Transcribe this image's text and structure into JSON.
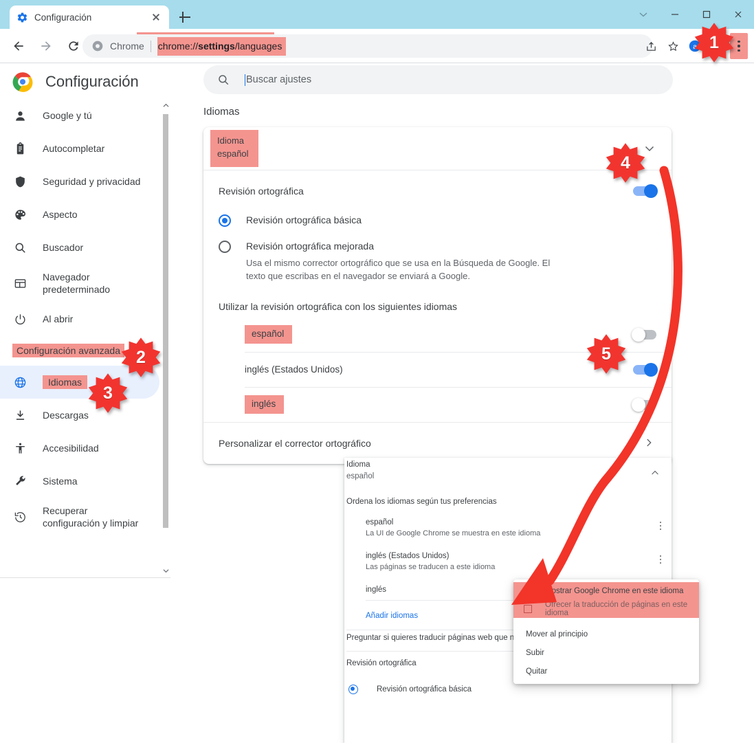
{
  "window": {
    "tab_title": "Configuración",
    "tab_favicon": "gear-icon",
    "controls": [
      "chevron-down-icon",
      "minimize-icon",
      "maximize-icon",
      "close-icon"
    ]
  },
  "omnibox": {
    "scope_label": "Chrome",
    "url_prefix": "chrome://",
    "url_bold": "settings",
    "url_suffix": "/languages",
    "url_full": "chrome://settings/languages"
  },
  "toolbar": {
    "back": "back-arrow-icon",
    "forward": "forward-arrow-icon",
    "reload": "reload-icon",
    "share": "share-icon",
    "bookmark": "star-icon",
    "profile": "avatar-a-icon",
    "extensions": "puzzle-icon",
    "menu": "three-dot-menu-icon"
  },
  "settings": {
    "brand_title": "Configuración",
    "search_placeholder": "Buscar ajustes",
    "search_value": ""
  },
  "sidebar": {
    "items": [
      {
        "label": "Google y tú",
        "icon": "person-icon"
      },
      {
        "label": "Autocompletar",
        "icon": "clipboard-icon"
      },
      {
        "label": "Seguridad y privacidad",
        "icon": "shield-icon"
      },
      {
        "label": "Aspecto",
        "icon": "palette-icon"
      },
      {
        "label": "Buscador",
        "icon": "search-icon"
      },
      {
        "label": "Navegador predeterminado",
        "icon": "browser-window-icon"
      },
      {
        "label": "Al abrir",
        "icon": "power-icon"
      }
    ],
    "advanced_label": "Configuración avanzada",
    "advanced_items": [
      {
        "label": "Idiomas",
        "icon": "globe-icon",
        "selected": true
      },
      {
        "label": "Descargas",
        "icon": "download-icon",
        "selected": false
      },
      {
        "label": "Accesibilidad",
        "icon": "accessibility-icon",
        "selected": false
      },
      {
        "label": "Sistema",
        "icon": "wrench-icon",
        "selected": false
      },
      {
        "label": "Recuperar configuración y limpiar",
        "icon": "history-icon",
        "selected": false
      }
    ]
  },
  "main": {
    "section_title": "Idiomas",
    "language_card": {
      "title": "Idioma",
      "value": "español",
      "expand_icon": "chevron-down-icon"
    },
    "spellcheck": {
      "label": "Revisión ortográfica",
      "enabled": true,
      "options": [
        {
          "title": "Revisión ortográfica básica",
          "desc": "",
          "checked": true
        },
        {
          "title": "Revisión ortográfica mejorada",
          "desc": "Usa el mismo corrector ortográfico que se usa en la Búsqueda de Google. El texto que escribas en el navegador se enviará a Google.",
          "checked": false
        }
      ],
      "languages_header": "Utilizar la revisión ortográfica con los siguientes idiomas",
      "languages": [
        {
          "name": "español",
          "enabled": false,
          "highlighted": true
        },
        {
          "name": "inglés (Estados Unidos)",
          "enabled": true,
          "highlighted": false
        },
        {
          "name": "inglés",
          "enabled": false,
          "highlighted": true
        }
      ],
      "customize_label": "Personalizar el corrector ortográfico"
    }
  },
  "overlay": {
    "title": "Idioma",
    "value": "español",
    "collapse_icon": "chevron-up-icon",
    "order_header": "Ordena los idiomas según tus preferencias",
    "languages": [
      {
        "name": "español",
        "desc": "La UI de Google Chrome se muestra en este idioma"
      },
      {
        "name": "inglés (Estados Unidos)",
        "desc": "Las páginas se traducen a este idioma"
      },
      {
        "name": "inglés",
        "desc": ""
      }
    ],
    "add_languages_label": "Añadir idiomas",
    "translate_prompt": "Preguntar si quieres traducir páginas web que no están es",
    "spellcheck_label": "Revisión ortográfica",
    "spellcheck_option": "Revisión ortográfica básica"
  },
  "context_menu": {
    "checkbox_items": [
      {
        "label": "Mostrar Google Chrome en este idioma",
        "checked": false,
        "muted": false
      },
      {
        "label": "Ofrecer la traducción de páginas en este idioma",
        "checked": false,
        "muted": true
      }
    ],
    "action_items": [
      {
        "label": "Mover al principio"
      },
      {
        "label": "Subir"
      },
      {
        "label": "Quitar"
      }
    ]
  },
  "annotations": {
    "badges": [
      {
        "number": "1",
        "target": "three-dot-menu-icon"
      },
      {
        "number": "2",
        "target": "sidebar-advanced-settings"
      },
      {
        "number": "3",
        "target": "sidebar-item-idiomas"
      },
      {
        "number": "4",
        "target": "language-card-expand"
      },
      {
        "number": "5",
        "target": "spellcheck-language-toggle-espanol"
      }
    ],
    "arrow_color": "#f23429",
    "highlight_color": "#f4948f"
  }
}
